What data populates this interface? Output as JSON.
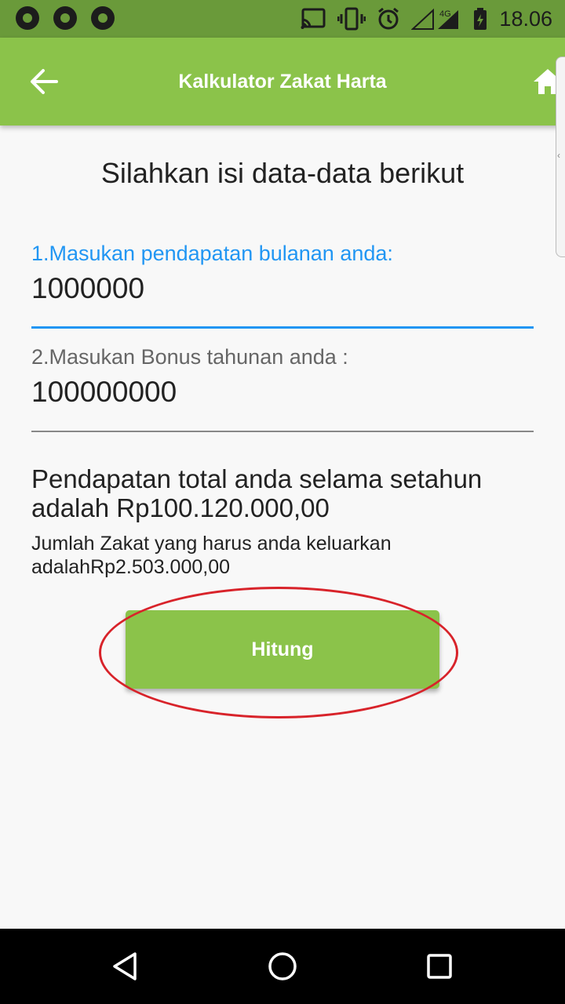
{
  "status_bar": {
    "time": "18.06",
    "network": "4G",
    "left_icons": [
      "aperture-icon",
      "aperture-icon",
      "aperture-icon"
    ],
    "right_icons": [
      "cast-icon",
      "vibrate-icon",
      "alarm-icon",
      "signal-icon",
      "battery-charging-icon"
    ]
  },
  "app_bar": {
    "title": "Kalkulator Zakat Harta",
    "left_icon": "back-arrow-icon",
    "right_icon": "home-icon"
  },
  "heading": "Silahkan isi data-data berikut",
  "fields": [
    {
      "label": "1.Masukan pendapatan bulanan anda:",
      "value": "1000000",
      "focused": true
    },
    {
      "label": "2.Masukan Bonus tahunan anda :",
      "value": "100000000",
      "focused": false
    }
  ],
  "result": {
    "total_text": "Pendapatan  total anda selama setahun adalah Rp100.120.000,00",
    "zakat_text": "Jumlah Zakat yang harus anda keluarkan adalahRp2.503.000,00"
  },
  "button": {
    "label": "Hitung"
  },
  "colors": {
    "primary": "#8bc34a",
    "status_bar": "#6a9a3a",
    "focus_blue": "#2196f3",
    "annotation_red": "#d8232a"
  },
  "nav_bar": {
    "icons": [
      "back-triangle-icon",
      "home-circle-icon",
      "recents-square-icon"
    ]
  }
}
